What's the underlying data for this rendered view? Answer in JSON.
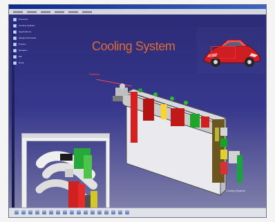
{
  "window": {
    "title": "Cooling System"
  },
  "viewport": {
    "heading": "Cooling System",
    "callout": "Radiator"
  },
  "tree": {
    "items": [
      {
        "label": "Product1",
        "icon": "product-icon"
      },
      {
        "label": "Cooling System",
        "icon": "assembly-icon"
      },
      {
        "label": "Applications",
        "icon": "folder-icon"
      },
      {
        "label": "Design Elements",
        "icon": "folder-icon"
      },
      {
        "label": "Engine",
        "icon": "part-icon"
      },
      {
        "label": "Radiator",
        "icon": "part-icon"
      },
      {
        "label": "Fan",
        "icon": "part-icon"
      },
      {
        "label": "Hose",
        "icon": "part-icon"
      }
    ]
  },
  "status_label": "Cooling System",
  "toolbar": {
    "buttons": [
      "select-icon",
      "rotate-icon",
      "pan-icon",
      "zoom-icon",
      "fit-icon",
      "normal-view-icon",
      "isometric-icon",
      "front-view-icon",
      "top-view-icon",
      "shading-icon",
      "wireframe-icon",
      "hide-icon",
      "measure-icon",
      "section-icon",
      "light-icon",
      "snapshot-icon",
      "help-icon"
    ]
  }
}
